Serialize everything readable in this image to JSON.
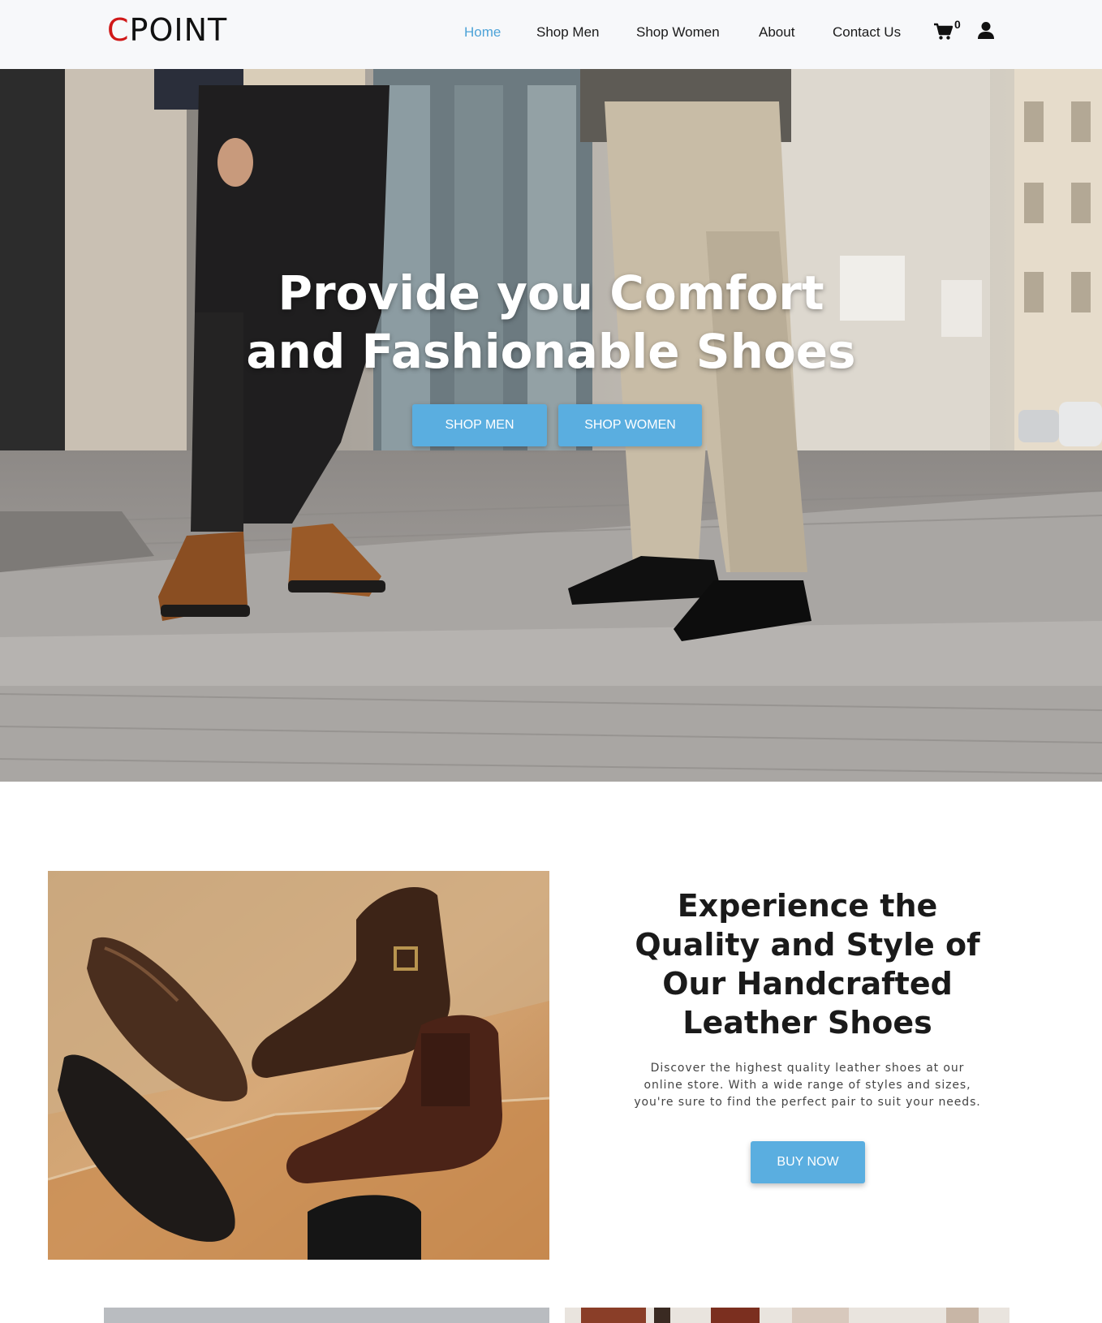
{
  "brand": {
    "logo_first": "C",
    "logo_rest": "POINT",
    "accent_color": "#d01818"
  },
  "nav": {
    "items": [
      {
        "label": "Home",
        "active": true
      },
      {
        "label": "Shop Men",
        "active": false
      },
      {
        "label": "Shop Women",
        "active": false
      },
      {
        "label": "About",
        "active": false
      },
      {
        "label": "Contact Us",
        "active": false
      }
    ],
    "cart_count": "0",
    "cart_icon": "shopping-cart-icon",
    "user_icon": "user-icon",
    "active_color": "#4ea3d8"
  },
  "hero": {
    "title_line1": "Provide you Comfort",
    "title_line2": "and Fashionable Shoes",
    "btn_men": "SHOP MEN",
    "btn_women": "SHOP WOMEN",
    "button_color": "#5aaee0"
  },
  "feature": {
    "heading_line1": "Experience the",
    "heading_line2": "Quality and Style of",
    "heading_line3": "Our Handcrafted",
    "heading_line4": "Leather Shoes",
    "text_line1": "Discover the highest quality leather shoes at our",
    "text_line2": "online store. With a wide range of styles and sizes,",
    "text_line3": "you're sure to find the perfect pair to suit your needs.",
    "button": "BUY NOW"
  }
}
